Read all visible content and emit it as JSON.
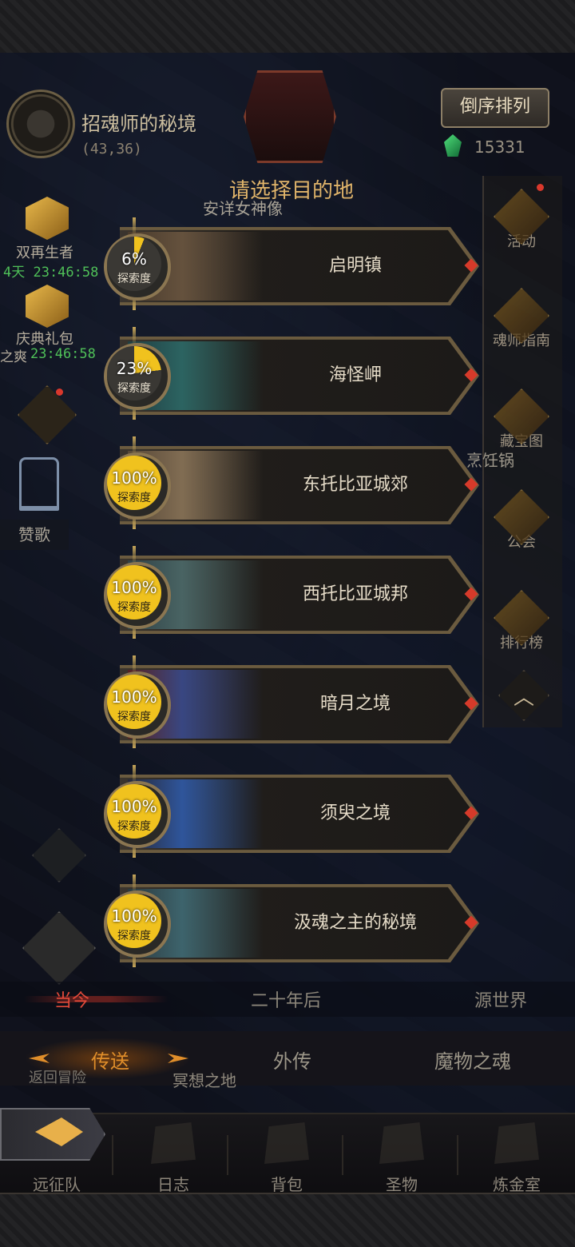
{
  "header": {
    "portal_name": "招魂师的秘境",
    "portal_coord": "(43,36)",
    "sort_label": "倒序排列",
    "gem_count": "15331"
  },
  "title": "请选择目的地",
  "background_labels": {
    "statue": "安详女神像",
    "cook": "烹饪锅",
    "return": "返回冒险",
    "meditate": "冥想之地"
  },
  "left_side": {
    "item1_label": "双再生者",
    "item1_timer": "4天 23:46:58",
    "item2_label": "庆典礼包",
    "item2_timer": "23:46:58",
    "item2_prefix": "之爽",
    "harp_label": "赞歌"
  },
  "right_menu": [
    {
      "label": "活动"
    },
    {
      "label": "魂师指南"
    },
    {
      "label": "藏宝图"
    },
    {
      "label": "公会"
    },
    {
      "label": "排行榜"
    }
  ],
  "destinations": [
    {
      "name": "启明镇",
      "progress": "6%",
      "progress_value": 6,
      "progress_label": "探索度"
    },
    {
      "name": "海怪岬",
      "progress": "23%",
      "progress_value": 23,
      "progress_label": "探索度"
    },
    {
      "name": "东托比亚城郊",
      "progress": "100%",
      "progress_value": 100,
      "progress_label": "探索度"
    },
    {
      "name": "西托比亚城邦",
      "progress": "100%",
      "progress_value": 100,
      "progress_label": "探索度"
    },
    {
      "name": "暗月之境",
      "progress": "100%",
      "progress_value": 100,
      "progress_label": "探索度"
    },
    {
      "name": "须臾之境",
      "progress": "100%",
      "progress_value": 100,
      "progress_label": "探索度"
    },
    {
      "name": "汲魂之主的秘境",
      "progress": "100%",
      "progress_value": 100,
      "progress_label": "探索度"
    }
  ],
  "era_tabs": {
    "current": "当今",
    "future": "二十年后",
    "origin": "源世界"
  },
  "func_tabs": {
    "teleport": "传送",
    "side_story": "外传",
    "monster_soul": "魔物之魂"
  },
  "nav": {
    "expedition": "远征队",
    "journal": "日志",
    "backpack": "背包",
    "relic": "圣物",
    "alchemy": "炼金室"
  },
  "colors": {
    "accent_gold": "#e0b46a",
    "active_orange": "#e08e2a",
    "active_red": "#e34a3a",
    "timer_green": "#4fc058"
  }
}
